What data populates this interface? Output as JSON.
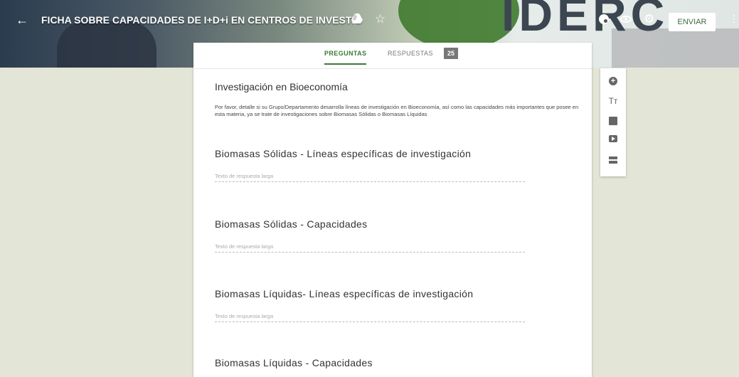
{
  "header": {
    "back_glyph": "←",
    "title": "FICHA SOBRE CAPACIDADES DE I+D+i EN CENTROS DE INVESTIG",
    "send_label": "ENVIAR"
  },
  "tabs": [
    {
      "label": "PREGUNTAS",
      "active": true
    },
    {
      "label": "RESPUESTAS",
      "active": false
    }
  ],
  "responses_count": "25",
  "section": {
    "title": "Investigación en Bioeconomía",
    "description": "Por favor, detalle si su Grupo/Departamento desarrolla líneas de investigación en Bioeconomía, así como las capacidades más importantes que posee en esta materia, ya se trate de investigaciones sobre Biomasas Sólidas o Biomasas Líquidas"
  },
  "questions": [
    {
      "title": "Biomasas Sólidas - Líneas específicas de investigación",
      "placeholder": "Texto de respuesta larga"
    },
    {
      "title": "Biomasas Sólidas - Capacidades",
      "placeholder": "Texto de respuesta larga"
    },
    {
      "title": "Biomasas Líquidas- Líneas específicas de investigación",
      "placeholder": "Texto de respuesta larga"
    },
    {
      "title": "Biomasas Líquidas - Capacidades",
      "placeholder": ""
    }
  ],
  "toolbar": {
    "title_icon_glyph": "Tт"
  },
  "colors": {
    "accent": "#3c7a36",
    "page_bg": "#e3e5d6"
  },
  "icons": [
    "back-arrow-icon",
    "drive-icon",
    "star-icon",
    "palette-icon",
    "eye-icon",
    "gear-icon",
    "more-icon",
    "add-icon",
    "title-icon",
    "image-icon",
    "video-icon",
    "section-icon"
  ]
}
